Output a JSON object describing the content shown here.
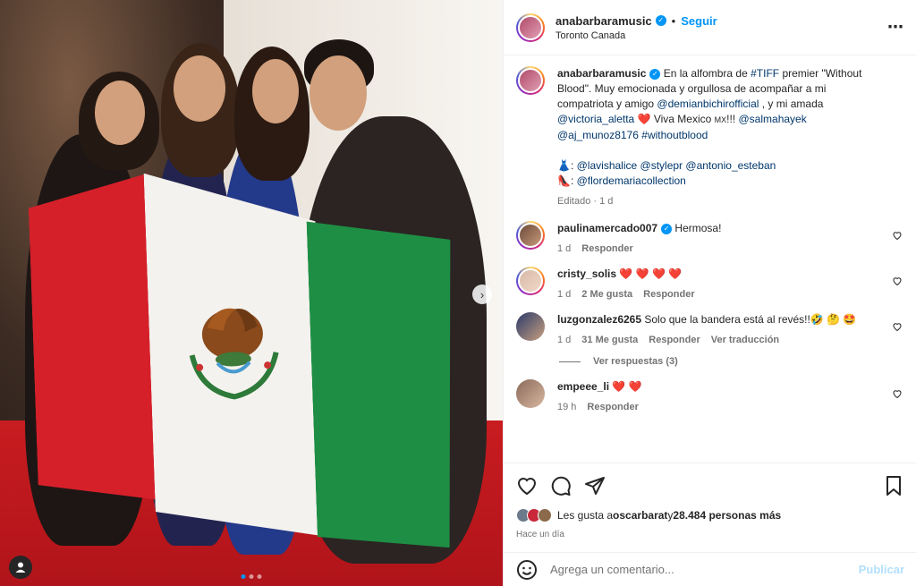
{
  "post": {
    "author": "anabarbaramusic",
    "follow_label": "Seguir",
    "separator": "•",
    "location": "Toronto Canada",
    "more_icon": "more-options-icon",
    "photo_dots": 3,
    "active_dot": 0
  },
  "caption": {
    "username": "anabarbaramusic",
    "text_1": " En la alfombra de ",
    "tag_tiff": "#TIFF",
    "text_2": " premier \"Without Blood\". Muy emocionada y orgullosa de acompañar a mi compatriota y amigo ",
    "mention_1": "@demianbichirofficial",
    "text_3": " , y mi amada ",
    "mention_2": "@victoria_aletta",
    "text_4": " ❤️ Viva Mexico ",
    "flag_text": "MX",
    "text_5": "!!! ",
    "mention_3": "@salmahayek",
    "mention_4": "@aj_munoz8176",
    "tag_2": "#withoutblood",
    "dress_emoji": "👗",
    "stylists_sep": ": ",
    "mention_5": "@lavishalice",
    "mention_6": "@stylepr",
    "mention_7": "@antonio_esteban",
    "shoe_emoji": "👠",
    "mention_8": "@flordemariacollection",
    "edited": "Editado · 1 d"
  },
  "comments": [
    {
      "username": "paulinamercado007",
      "verified": true,
      "text": "Hermosa!",
      "time": "1 d",
      "likes": "",
      "reply": "Responder",
      "translate": ""
    },
    {
      "username": "cristy_solis",
      "verified": false,
      "text": "❤️ ❤️ ❤️ ❤️",
      "time": "1 d",
      "likes": "2 Me gusta",
      "reply": "Responder",
      "translate": ""
    },
    {
      "username": "luzgonzalez6265",
      "verified": false,
      "text": "Solo que la bandera está al revés!!🤣 🤔 🤩",
      "time": "1 d",
      "likes": "31 Me gusta",
      "reply": "Responder",
      "translate": "Ver traducción"
    },
    {
      "username": "empeee_li",
      "verified": false,
      "text": "❤️ ❤️",
      "time": "19 h",
      "likes": "",
      "reply": "Responder",
      "translate": ""
    }
  ],
  "view_replies": "Ver respuestas (3)",
  "likes": {
    "prefix": "Les gusta a ",
    "user": "oscarbarat",
    "middle": " y ",
    "count": "28.484 personas más"
  },
  "posted_time": "Hace un día",
  "add_comment": {
    "placeholder": "Agrega un comentario...",
    "publish": "Publicar"
  },
  "colors": {
    "accent": "#0095f6",
    "mention": "#00376b",
    "heart": "#ed4956",
    "flag_red": "#d5202a",
    "flag_green": "#1e8e44"
  }
}
